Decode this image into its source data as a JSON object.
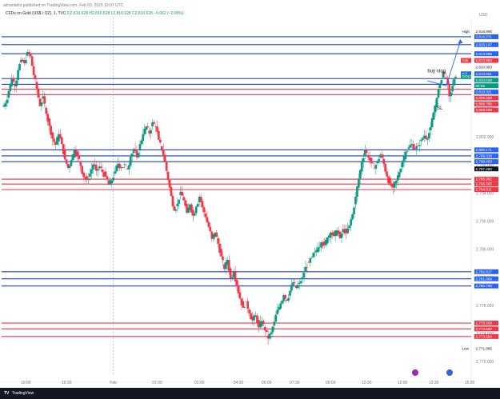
{
  "header": {
    "published_by": "azhantahir published on TradingView.com, Feb 03, 2025 13:07 UTC",
    "symbol": "CFDs on Gold (US$ / OZ), 1, TVC",
    "ohlc": "O2,810.628  H2,810.628  L2,810.628  C2,810.628  −0.062 (−0.00%)"
  },
  "footer": {
    "logo_mark": "TV",
    "logo_text": "TradingView"
  },
  "chart_data": {
    "type": "candlestick",
    "currency": "USD",
    "ylim": [
      2768,
      2819
    ],
    "price_ticks": [
      2770,
      2774,
      2778,
      2782,
      2786,
      2790,
      2794,
      2798,
      2802,
      2806
    ],
    "price_tick_labels": [
      "2,770.000",
      "2,774.000",
      "2,778.000",
      "2,782.000",
      "2,786.000",
      "2,790.000",
      "2,794.000",
      "2,798.000",
      "2,802.000",
      "2,806.000"
    ],
    "time_ticks": [
      {
        "label": "18:00",
        "bar": 14
      },
      {
        "label": "19:30",
        "bar": 40
      },
      {
        "label": "Feb",
        "bar": 70
      },
      {
        "label": "01:00",
        "bar": 98
      },
      {
        "label": "03:00",
        "bar": 125
      },
      {
        "label": "04:30",
        "bar": 150
      },
      {
        "label": "06:00",
        "bar": 168
      },
      {
        "label": "07:30",
        "bar": 186
      },
      {
        "label": "09:00",
        "bar": 209
      },
      {
        "label": "10:30",
        "bar": 232
      },
      {
        "label": "12:00",
        "bar": 255
      },
      {
        "label": "13:30",
        "bar": 275
      },
      {
        "label": "15:00",
        "bar": 298
      }
    ],
    "blue_levels": [
      2816.271,
      2815.147,
      2813.856,
      2810.321,
      2809.499,
      2800.171,
      2799.318,
      2798.493,
      2782.817,
      2781.809,
      2780.79
    ],
    "red_levels": [
      2808.789,
      2808.039,
      2795.992,
      2795.305,
      2794.511,
      2775.509,
      2774.68,
      2773.594
    ],
    "labels": [
      {
        "text": "High",
        "value": 2816.995,
        "kind": "gray"
      },
      {
        "text": "2,816.995",
        "value": 2816.995,
        "kind": "plain"
      },
      {
        "text": "2,816.271",
        "value": 2816.271,
        "kind": "blue"
      },
      {
        "text": "2,815.147",
        "value": 2815.147,
        "kind": "blue"
      },
      {
        "text": "2,813.856",
        "value": 2813.856,
        "kind": "blue"
      },
      {
        "text": "Ask",
        "value": 2812.9,
        "kind": "red"
      },
      {
        "text": "2,812.983",
        "value": 2812.9,
        "kind": "red"
      },
      {
        "text": "2,810.993",
        "value": 2811.95,
        "kind": "plain"
      },
      {
        "text": "Bid",
        "value": 2811.0,
        "kind": "blue"
      },
      {
        "text": "2,810.661",
        "value": 2811.0,
        "kind": "blue"
      },
      {
        "text": "GOLD",
        "value": 2810.628,
        "kind": "green"
      },
      {
        "text": "2,810.628",
        "value": 2810.1,
        "kind": "green"
      },
      {
        "text": "00:56",
        "value": 2809.3,
        "kind": "green"
      },
      {
        "text": "2,810.321",
        "value": 2808.4,
        "kind": "blue"
      },
      {
        "text": "2,809.499",
        "value": 2807.55,
        "kind": "red"
      },
      {
        "text": "2,808.789",
        "value": 2806.7,
        "kind": "red"
      },
      {
        "text": "2,808.039",
        "value": 2805.85,
        "kind": "red"
      },
      {
        "text": "2,800.171",
        "value": 2800.171,
        "kind": "blue"
      },
      {
        "text": "2,799.318",
        "value": 2799.318,
        "kind": "blue"
      },
      {
        "text": "2,798.493",
        "value": 2798.493,
        "kind": "blue"
      },
      {
        "text": "2,797.460",
        "value": 2797.46,
        "kind": "dark"
      },
      {
        "text": "2,795.992",
        "value": 2795.992,
        "kind": "red"
      },
      {
        "text": "2,795.305",
        "value": 2795.305,
        "kind": "red"
      },
      {
        "text": "2,794.511",
        "value": 2794.511,
        "kind": "red"
      },
      {
        "text": "2,782.817",
        "value": 2782.817,
        "kind": "blue"
      },
      {
        "text": "2,781.809",
        "value": 2781.809,
        "kind": "blue"
      },
      {
        "text": "2,780.790",
        "value": 2780.79,
        "kind": "blue"
      },
      {
        "text": "2,775.509",
        "value": 2775.509,
        "kind": "red"
      },
      {
        "text": "2,774.680",
        "value": 2774.68,
        "kind": "red"
      },
      {
        "text": "2,773.594",
        "value": 2773.594,
        "kind": "red"
      },
      {
        "text": "Low",
        "value": 2771.885,
        "kind": "gray"
      },
      {
        "text": "2,771.885",
        "value": 2771.885,
        "kind": "plain"
      }
    ],
    "annotations": [
      {
        "text": "buy stop",
        "bar": 271,
        "value": 2811.2
      },
      {
        "text": "SL",
        "bar": 277,
        "value": 2805.9
      }
    ],
    "projection": {
      "points": [
        [
          271,
          2810.0
        ],
        [
          283,
          2809.3
        ],
        [
          292,
          2815.6
        ]
      ],
      "color": "#2962ff"
    },
    "session_break_bar": 70,
    "candles_sampled_close": [
      2806.8,
      2808.5,
      2810.4,
      2809.2,
      2811.5,
      2813.0,
      2812.5,
      2814.1,
      2813.5,
      2810.8,
      2808.9,
      2806.4,
      2807.8,
      2805.3,
      2803.6,
      2801.8,
      2800.9,
      2802.4,
      2801.0,
      2798.8,
      2797.6,
      2798.7,
      2800.1,
      2799.4,
      2797.9,
      2796.3,
      2795.9,
      2796.8,
      2798.1,
      2797.2,
      2797.8,
      2797.0,
      2796.4,
      2795.2,
      2795.8,
      2797.1,
      2798.2,
      2797.6,
      2798.1,
      2797.4,
      2799.2,
      2800.3,
      2799.1,
      2801.0,
      2802.4,
      2803.5,
      2802.5,
      2804.1,
      2803.5,
      2801.6,
      2800.2,
      2798.5,
      2795.9,
      2793.6,
      2791.5,
      2792.5,
      2794.2,
      2793.0,
      2791.2,
      2792.4,
      2790.8,
      2792.1,
      2793.5,
      2792.0,
      2790.6,
      2789.2,
      2787.5,
      2788.4,
      2786.8,
      2785.0,
      2783.2,
      2784.5,
      2781.9,
      2782.8,
      2780.9,
      2779.0,
      2777.7,
      2778.6,
      2776.9,
      2775.9,
      2776.6,
      2774.9,
      2775.8,
      2774.5,
      2773.3,
      2774.2,
      2775.7,
      2777.4,
      2778.3,
      2779.5,
      2778.7,
      2780.1,
      2781.3,
      2780.5,
      2781.2,
      2782.0,
      2783.5,
      2784.1,
      2784.9,
      2785.6,
      2786.3,
      2787.0,
      2786.6,
      2787.7,
      2788.4,
      2787.9,
      2788.7,
      2787.6,
      2788.9,
      2788.3,
      2789.4,
      2791.0,
      2793.5,
      2796.1,
      2798.4,
      2800.2,
      2799.1,
      2798.3,
      2797.5,
      2798.6,
      2799.5,
      2798.2,
      2796.4,
      2795.2,
      2794.8,
      2795.8,
      2797.0,
      2798.6,
      2799.9,
      2800.5,
      2801.0,
      2800.3,
      2800.7,
      2801.6,
      2802.2,
      2801.8,
      2803.4,
      2805.5,
      2807.6,
      2809.6,
      2811.3,
      2810.4,
      2807.8,
      2809.3,
      2810.6
    ]
  }
}
